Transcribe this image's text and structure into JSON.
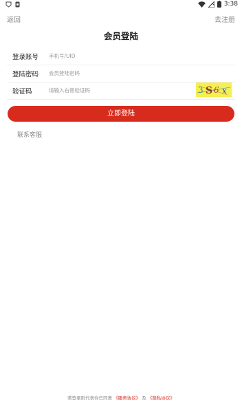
{
  "status_bar": {
    "time": "3:38",
    "left_icons": [
      "notification-icon",
      "sim-card-icon"
    ],
    "right_icons": [
      "wifi-icon",
      "signal-icon",
      "battery-icon"
    ]
  },
  "nav": {
    "back_label": "返回",
    "register_label": "去注册"
  },
  "title": "会员登陆",
  "form": {
    "account": {
      "label": "登录账号",
      "placeholder": "手机号/UID",
      "value": ""
    },
    "password": {
      "label": "登陆密码",
      "placeholder": "会员登陆密码",
      "value": ""
    },
    "captcha": {
      "label": "验证码",
      "placeholder": "请输入右侧验证码",
      "value": "",
      "image_text": "3S6x"
    }
  },
  "login_button": "立即登陆",
  "service_link": "联系客服",
  "agreement": {
    "prefix": "若登录则代表你已同意",
    "service_terms": "《服务协议》",
    "conjunction": "及",
    "privacy_terms": "《隐私协议》"
  },
  "colors": {
    "accent": "#d72c1d",
    "captcha_bg": "#f5ef52",
    "muted_text": "#8a8a8a"
  }
}
